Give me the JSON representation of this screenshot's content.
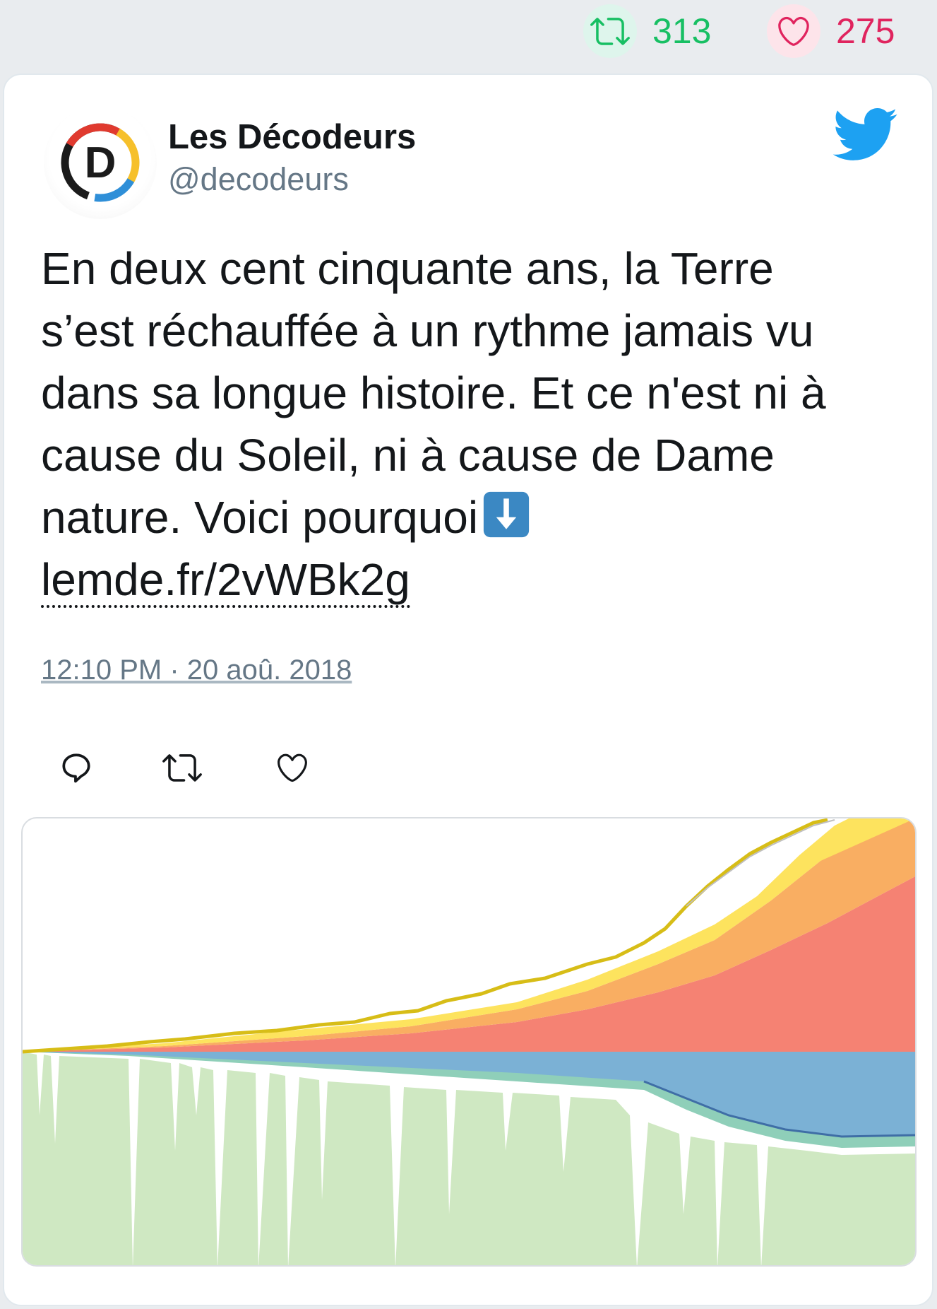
{
  "stats": {
    "retweets": "313",
    "likes": "275",
    "retweet_icon": "retweet-icon",
    "like_icon": "heart-icon"
  },
  "tweet": {
    "author_name": "Les Décodeurs",
    "author_handle": "@decodeurs",
    "avatar_letter": "D",
    "text_lines": [
      "En deux cent cinquante ans, la Terre",
      "s’est réchauffée à un rythme jamais vu",
      "dans sa longue histoire. Et ce n'est ni à",
      "cause du Soleil, ni à cause de Dame",
      "nature. Voici pourquoi"
    ],
    "link": "lemde.fr/2vWBk2g",
    "timestamp": "12:10 PM · 20 aoû. 2018"
  },
  "colors": {
    "retweet": "#17bf63",
    "like": "#e0245e",
    "twitter_blue": "#1da1f2",
    "muted": "#657786"
  },
  "icons": {
    "reply": "reply-icon",
    "retweet": "retweet-icon",
    "like": "heart-icon",
    "bird": "twitter-bird-icon",
    "down_arrow": "down-arrow-emoji"
  }
}
